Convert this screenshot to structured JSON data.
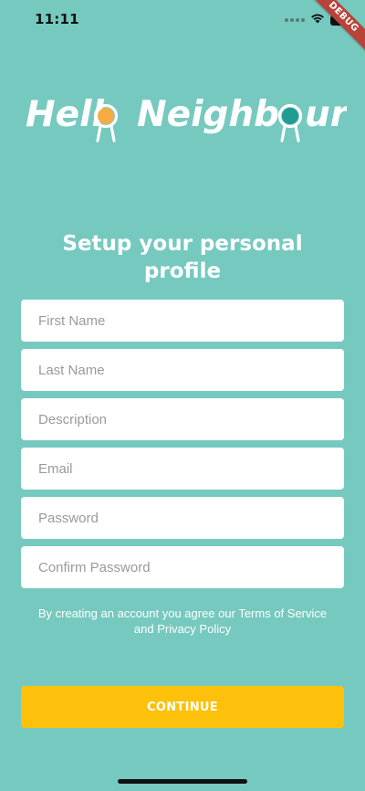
{
  "status_bar": {
    "time": "11:11",
    "icons": [
      "signal-dots-icon",
      "wifi-icon",
      "battery-icon"
    ]
  },
  "debug_banner": "DEBUG",
  "logo": {
    "text": "Hello Neighbour",
    "colors": {
      "text": "#ffffff",
      "first_dot": "#f6ac45",
      "second_dot": "#1f9c94"
    }
  },
  "heading": "Setup your personal profile",
  "form": {
    "first_name_placeholder": "First Name",
    "last_name_placeholder": "Last Name",
    "description_placeholder": "Description",
    "email_placeholder": "Email",
    "password_placeholder": "Password",
    "confirm_password_placeholder": "Confirm Password"
  },
  "terms_text": "By creating an account you agree our Terms of Service and Privacy Policy",
  "continue_label": "CONTINUE",
  "colors": {
    "background": "#76c9bf",
    "button": "#fdc10c",
    "field_background": "#ffffff"
  }
}
